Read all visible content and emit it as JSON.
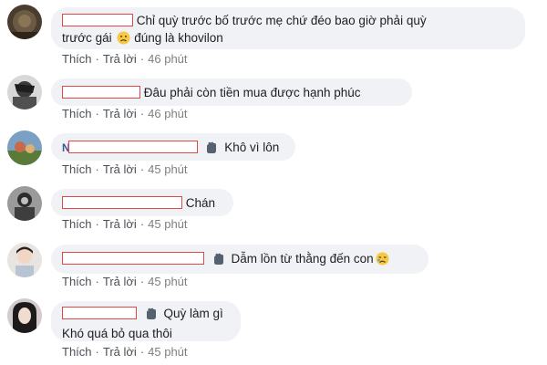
{
  "comments": [
    {
      "text_line1": "Chỉ quỳ trước bố trước mẹ chứ đéo bao giờ phải quỳ",
      "text_line2_a": "trước gái",
      "text_line2_b": "đúng là khovilon",
      "emoji": "crying-face",
      "actions": {
        "like": "Thích",
        "reply": "Trả lời",
        "time": "46 phút"
      }
    },
    {
      "text": "Đâu phải còn tiền mua được hạnh phúc",
      "actions": {
        "like": "Thích",
        "reply": "Trả lời",
        "time": "46 phút"
      }
    },
    {
      "text": "Khô vì lôn",
      "emoji": "waving-hand",
      "actions": {
        "like": "Thích",
        "reply": "Trả lời",
        "time": "45 phút"
      }
    },
    {
      "text": "Chán",
      "actions": {
        "like": "Thích",
        "reply": "Trả lời",
        "time": "45 phút"
      }
    },
    {
      "text": "Dẫm lồn từ thằng đến con",
      "emoji": "waving-hand",
      "emoji_end": "crying-face",
      "actions": {
        "like": "Thích",
        "reply": "Trả lời",
        "time": "45 phút"
      }
    },
    {
      "text_line1": "Quỳ làm gì",
      "text_line2": "Khó quá bỏ qua thôi",
      "emoji": "waving-hand",
      "actions": {
        "like": "Thích",
        "reply": "Trả lời",
        "time": "45 phút"
      }
    }
  ],
  "colors": {
    "bubble": "#f0f2f5",
    "text": "#1c1e21",
    "action": "#65676b",
    "redaction_border": "#e04848"
  }
}
